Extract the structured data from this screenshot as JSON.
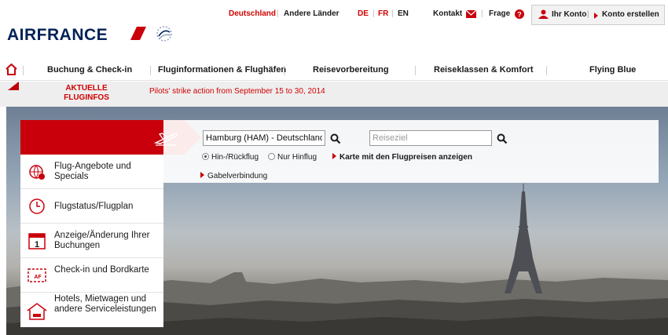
{
  "header": {
    "logo_text": "AIRFRANCE",
    "country_current": "Deutschland",
    "country_other": "Andere Länder",
    "languages": [
      "DE",
      "FR",
      "EN"
    ],
    "contact": "Kontakt",
    "question": "Frage",
    "account": "Ihr Konto",
    "create_account": "Konto erstellen"
  },
  "nav": {
    "items": [
      "Buchung & Check-in",
      "Fluginformationen & Flughäfen",
      "Reisevorbereitung",
      "Reiseklassen & Komfort",
      "Flying Blue"
    ]
  },
  "infobar": {
    "label": "AKTUELLE FLUGINFOS",
    "message": "Pilots' strike action from September 15 to 30, 2014"
  },
  "menu": {
    "items": [
      {
        "label": "Flug-Angebote und Specials",
        "icon": "globe-offer-icon"
      },
      {
        "label": "Flugstatus/Flugplan",
        "icon": "clock-icon"
      },
      {
        "label": "Anzeige/Änderung Ihrer Buchungen",
        "icon": "calendar-icon"
      },
      {
        "label": "Check-in und Bordkarte",
        "icon": "boarding-pass-icon"
      },
      {
        "label": "Hotels, Mietwagen und andere Serviceleistungen",
        "icon": "hotel-icon"
      }
    ]
  },
  "search": {
    "from_value": "Hamburg (HAM) - Deutschland",
    "to_placeholder": "Reiseziel",
    "roundtrip": "Hin-/Rückflug",
    "oneway": "Nur Hinflug",
    "map_link": "Karte mit den Flugpreisen anzeigen",
    "openjaw": "Gabelverbindung"
  },
  "colors": {
    "brand_red": "#c9000b",
    "brand_blue": "#002157"
  }
}
